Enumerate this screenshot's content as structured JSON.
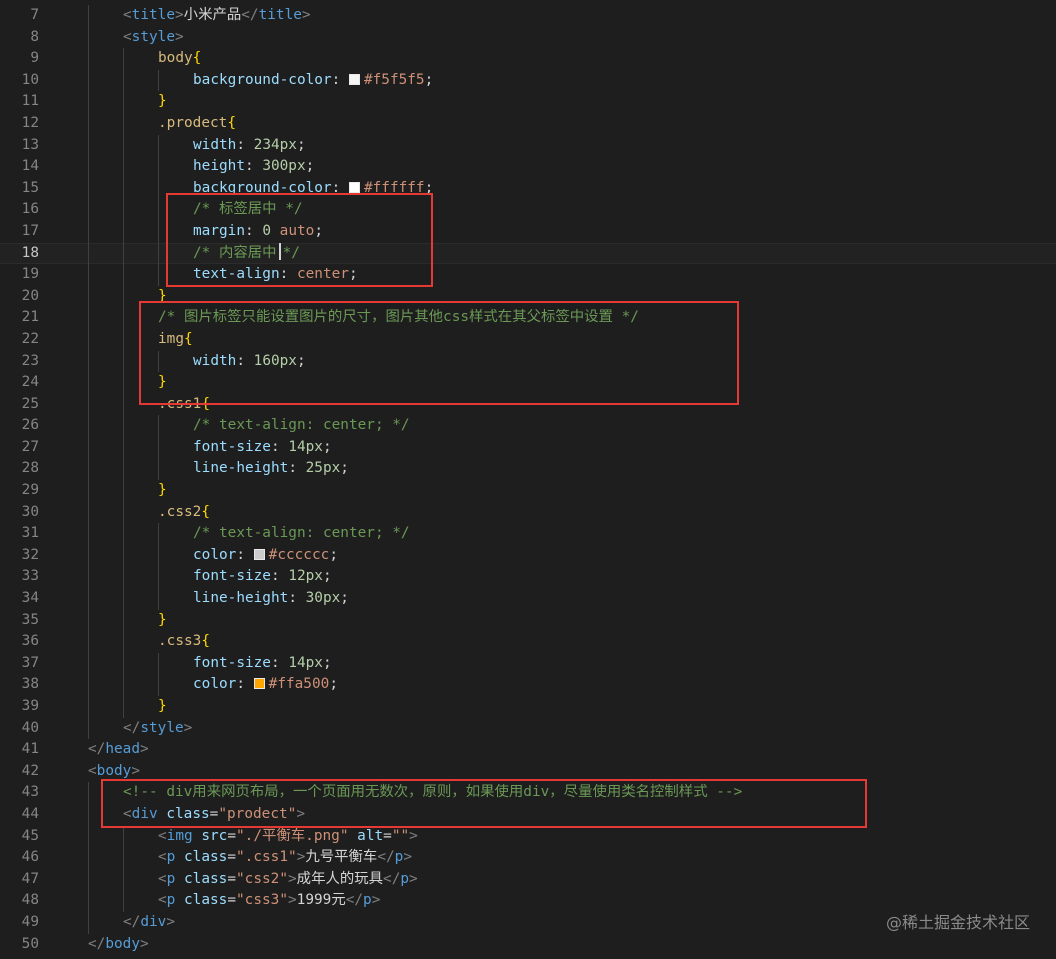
{
  "colors": {
    "background": "#1e1e1e",
    "highlight_box": "#e53935",
    "swatch_f5f5f5": "#f5f5f5",
    "swatch_ffffff": "#ffffff",
    "swatch_cccccc": "#cccccc",
    "swatch_ffa500": "#ffa500"
  },
  "watermark": "@稀土掘金技术社区",
  "lines": [
    {
      "n": "7",
      "indent": 1,
      "tokens": [
        [
          "c-bracket",
          "<"
        ],
        [
          "c-tag",
          "title"
        ],
        [
          "c-bracket",
          ">"
        ],
        [
          "c-text",
          "小米产品"
        ],
        [
          "c-bracket",
          "</"
        ],
        [
          "c-tag",
          "title"
        ],
        [
          "c-bracket",
          ">"
        ]
      ]
    },
    {
      "n": "8",
      "indent": 1,
      "tokens": [
        [
          "c-bracket",
          "<"
        ],
        [
          "c-tag",
          "style"
        ],
        [
          "c-bracket",
          ">"
        ]
      ]
    },
    {
      "n": "9",
      "indent": 2,
      "tokens": [
        [
          "c-sel",
          "body"
        ],
        [
          "c-brace",
          "{"
        ]
      ]
    },
    {
      "n": "10",
      "indent": 3,
      "tokens": [
        [
          "c-prop",
          "background-color"
        ],
        [
          "c-punct",
          ": "
        ],
        [
          "swatch",
          "#f5f5f5"
        ],
        [
          "c-value",
          "#f5f5f5"
        ],
        [
          "c-punct",
          ";"
        ]
      ]
    },
    {
      "n": "11",
      "indent": 2,
      "tokens": [
        [
          "c-brace",
          "}"
        ]
      ]
    },
    {
      "n": "12",
      "indent": 2,
      "tokens": [
        [
          "c-sel",
          ".prodect"
        ],
        [
          "c-brace",
          "{"
        ]
      ]
    },
    {
      "n": "13",
      "indent": 3,
      "tokens": [
        [
          "c-prop",
          "width"
        ],
        [
          "c-punct",
          ": "
        ],
        [
          "c-num",
          "234px"
        ],
        [
          "c-punct",
          ";"
        ]
      ]
    },
    {
      "n": "14",
      "indent": 3,
      "tokens": [
        [
          "c-prop",
          "height"
        ],
        [
          "c-punct",
          ": "
        ],
        [
          "c-num",
          "300px"
        ],
        [
          "c-punct",
          ";"
        ]
      ]
    },
    {
      "n": "15",
      "indent": 3,
      "tokens": [
        [
          "c-prop",
          "background-color"
        ],
        [
          "c-punct",
          ": "
        ],
        [
          "swatch",
          "#ffffff"
        ],
        [
          "c-value",
          "#ffffff"
        ],
        [
          "c-punct",
          ";"
        ]
      ]
    },
    {
      "n": "16",
      "indent": 3,
      "tokens": [
        [
          "c-comment",
          "/* 标签居中 */"
        ]
      ]
    },
    {
      "n": "17",
      "indent": 3,
      "tokens": [
        [
          "c-prop",
          "margin"
        ],
        [
          "c-punct",
          ": "
        ],
        [
          "c-num",
          "0"
        ],
        [
          "c-punct",
          " "
        ],
        [
          "c-value",
          "auto"
        ],
        [
          "c-punct",
          ";"
        ]
      ]
    },
    {
      "n": "18",
      "indent": 3,
      "current": true,
      "tokens": [
        [
          "c-comment",
          "/* 内容居中"
        ],
        [
          "caret",
          ""
        ],
        [
          "c-comment",
          "*/"
        ]
      ]
    },
    {
      "n": "19",
      "indent": 3,
      "tokens": [
        [
          "c-prop",
          "text-align"
        ],
        [
          "c-punct",
          ": "
        ],
        [
          "c-value",
          "center"
        ],
        [
          "c-punct",
          ";"
        ]
      ]
    },
    {
      "n": "20",
      "indent": 2,
      "tokens": [
        [
          "c-brace",
          "}"
        ]
      ]
    },
    {
      "n": "21",
      "indent": 2,
      "tokens": [
        [
          "c-comment",
          "/* 图片标签只能设置图片的尺寸，图片其他css样式在其父标签中设置 */"
        ]
      ]
    },
    {
      "n": "22",
      "indent": 2,
      "tokens": [
        [
          "c-sel",
          "img"
        ],
        [
          "c-brace",
          "{"
        ]
      ]
    },
    {
      "n": "23",
      "indent": 3,
      "tokens": [
        [
          "c-prop",
          "width"
        ],
        [
          "c-punct",
          ": "
        ],
        [
          "c-num",
          "160px"
        ],
        [
          "c-punct",
          ";"
        ]
      ]
    },
    {
      "n": "24",
      "indent": 2,
      "tokens": [
        [
          "c-brace",
          "}"
        ]
      ]
    },
    {
      "n": "25",
      "indent": 2,
      "tokens": [
        [
          "c-sel",
          ".css1"
        ],
        [
          "c-brace",
          "{"
        ]
      ]
    },
    {
      "n": "26",
      "indent": 3,
      "tokens": [
        [
          "c-comment",
          "/* text-align: center; */"
        ]
      ]
    },
    {
      "n": "27",
      "indent": 3,
      "tokens": [
        [
          "c-prop",
          "font-size"
        ],
        [
          "c-punct",
          ": "
        ],
        [
          "c-num",
          "14px"
        ],
        [
          "c-punct",
          ";"
        ]
      ]
    },
    {
      "n": "28",
      "indent": 3,
      "tokens": [
        [
          "c-prop",
          "line-height"
        ],
        [
          "c-punct",
          ": "
        ],
        [
          "c-num",
          "25px"
        ],
        [
          "c-punct",
          ";"
        ]
      ]
    },
    {
      "n": "29",
      "indent": 2,
      "tokens": [
        [
          "c-brace",
          "}"
        ]
      ]
    },
    {
      "n": "30",
      "indent": 2,
      "tokens": [
        [
          "c-sel",
          ".css2"
        ],
        [
          "c-brace",
          "{"
        ]
      ]
    },
    {
      "n": "31",
      "indent": 3,
      "tokens": [
        [
          "c-comment",
          "/* text-align: center; */"
        ]
      ]
    },
    {
      "n": "32",
      "indent": 3,
      "tokens": [
        [
          "c-prop",
          "color"
        ],
        [
          "c-punct",
          ": "
        ],
        [
          "swatch",
          "#cccccc"
        ],
        [
          "c-value",
          "#cccccc"
        ],
        [
          "c-punct",
          ";"
        ]
      ]
    },
    {
      "n": "33",
      "indent": 3,
      "tokens": [
        [
          "c-prop",
          "font-size"
        ],
        [
          "c-punct",
          ": "
        ],
        [
          "c-num",
          "12px"
        ],
        [
          "c-punct",
          ";"
        ]
      ]
    },
    {
      "n": "34",
      "indent": 3,
      "tokens": [
        [
          "c-prop",
          "line-height"
        ],
        [
          "c-punct",
          ": "
        ],
        [
          "c-num",
          "30px"
        ],
        [
          "c-punct",
          ";"
        ]
      ]
    },
    {
      "n": "35",
      "indent": 2,
      "tokens": [
        [
          "c-brace",
          "}"
        ]
      ]
    },
    {
      "n": "36",
      "indent": 2,
      "tokens": [
        [
          "c-sel",
          ".css3"
        ],
        [
          "c-brace",
          "{"
        ]
      ]
    },
    {
      "n": "37",
      "indent": 3,
      "tokens": [
        [
          "c-prop",
          "font-size"
        ],
        [
          "c-punct",
          ": "
        ],
        [
          "c-num",
          "14px"
        ],
        [
          "c-punct",
          ";"
        ]
      ]
    },
    {
      "n": "38",
      "indent": 3,
      "tokens": [
        [
          "c-prop",
          "color"
        ],
        [
          "c-punct",
          ": "
        ],
        [
          "swatch",
          "#ffa500"
        ],
        [
          "c-value",
          "#ffa500"
        ],
        [
          "c-punct",
          ";"
        ]
      ]
    },
    {
      "n": "39",
      "indent": 2,
      "tokens": [
        [
          "c-brace",
          "}"
        ]
      ]
    },
    {
      "n": "40",
      "indent": 1,
      "tokens": [
        [
          "c-bracket",
          "</"
        ],
        [
          "c-tag",
          "style"
        ],
        [
          "c-bracket",
          ">"
        ]
      ]
    },
    {
      "n": "41",
      "indent": 0,
      "tokens": [
        [
          "c-bracket",
          "</"
        ],
        [
          "c-tag",
          "head"
        ],
        [
          "c-bracket",
          ">"
        ]
      ]
    },
    {
      "n": "42",
      "indent": 0,
      "tokens": [
        [
          "c-bracket",
          "<"
        ],
        [
          "c-tag",
          "body"
        ],
        [
          "c-bracket",
          ">"
        ]
      ]
    },
    {
      "n": "43",
      "indent": 1,
      "tokens": [
        [
          "c-comment",
          "<!-- div用来网页布局，一个页面用无数次，原则，如果使用div，尽量使用类名控制样式 -->"
        ]
      ]
    },
    {
      "n": "44",
      "indent": 1,
      "tokens": [
        [
          "c-bracket",
          "<"
        ],
        [
          "c-tag",
          "div"
        ],
        [
          "c-punct",
          " "
        ],
        [
          "c-attr",
          "class"
        ],
        [
          "c-punct",
          "="
        ],
        [
          "c-str",
          "\"prodect\""
        ],
        [
          "c-bracket",
          ">"
        ]
      ]
    },
    {
      "n": "45",
      "indent": 2,
      "tokens": [
        [
          "c-bracket",
          "<"
        ],
        [
          "c-tag",
          "img"
        ],
        [
          "c-punct",
          " "
        ],
        [
          "c-attr",
          "src"
        ],
        [
          "c-punct",
          "="
        ],
        [
          "c-str",
          "\"./平衡车.png\""
        ],
        [
          "c-punct",
          " "
        ],
        [
          "c-attr",
          "alt"
        ],
        [
          "c-punct",
          "="
        ],
        [
          "c-str",
          "\"\""
        ],
        [
          "c-bracket",
          ">"
        ]
      ]
    },
    {
      "n": "46",
      "indent": 2,
      "tokens": [
        [
          "c-bracket",
          "<"
        ],
        [
          "c-tag",
          "p"
        ],
        [
          "c-punct",
          " "
        ],
        [
          "c-attr",
          "class"
        ],
        [
          "c-punct",
          "="
        ],
        [
          "c-str",
          "\".css1\""
        ],
        [
          "c-bracket",
          ">"
        ],
        [
          "c-text",
          "九号平衡车"
        ],
        [
          "c-bracket",
          "</"
        ],
        [
          "c-tag",
          "p"
        ],
        [
          "c-bracket",
          ">"
        ]
      ]
    },
    {
      "n": "47",
      "indent": 2,
      "tokens": [
        [
          "c-bracket",
          "<"
        ],
        [
          "c-tag",
          "p"
        ],
        [
          "c-punct",
          " "
        ],
        [
          "c-attr",
          "class"
        ],
        [
          "c-punct",
          "="
        ],
        [
          "c-str",
          "\"css2\""
        ],
        [
          "c-bracket",
          ">"
        ],
        [
          "c-text",
          "成年人的玩具"
        ],
        [
          "c-bracket",
          "</"
        ],
        [
          "c-tag",
          "p"
        ],
        [
          "c-bracket",
          ">"
        ]
      ]
    },
    {
      "n": "48",
      "indent": 2,
      "tokens": [
        [
          "c-bracket",
          "<"
        ],
        [
          "c-tag",
          "p"
        ],
        [
          "c-punct",
          " "
        ],
        [
          "c-attr",
          "class"
        ],
        [
          "c-punct",
          "="
        ],
        [
          "c-str",
          "\"css3\""
        ],
        [
          "c-bracket",
          ">"
        ],
        [
          "c-text",
          "1999元"
        ],
        [
          "c-bracket",
          "</"
        ],
        [
          "c-tag",
          "p"
        ],
        [
          "c-bracket",
          ">"
        ]
      ]
    },
    {
      "n": "49",
      "indent": 1,
      "tokens": [
        [
          "c-bracket",
          "</"
        ],
        [
          "c-tag",
          "div"
        ],
        [
          "c-bracket",
          ">"
        ]
      ]
    },
    {
      "n": "50",
      "indent": 0,
      "tokens": [
        [
          "c-bracket",
          "</"
        ],
        [
          "c-tag",
          "body"
        ],
        [
          "c-bracket",
          ">"
        ]
      ]
    }
  ]
}
